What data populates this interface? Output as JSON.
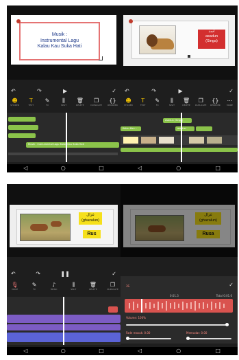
{
  "panel1": {
    "title_lines": [
      "Musik :",
      "Instrumental Lagu",
      "Kalau Kau Suka Hati"
    ],
    "music_clip_label": "Musik : Instrumental Lagu Kalau Kau Suka Hati",
    "tools": [
      {
        "icon": "sticker",
        "label": "STICKER"
      },
      {
        "icon": "T",
        "label": "TEXT"
      },
      {
        "icon": "pen",
        "label": "FX"
      },
      {
        "icon": "split",
        "label": "SPLIT"
      },
      {
        "icon": "delete",
        "label": "DELETE"
      },
      {
        "icon": "copy",
        "label": "DUPLICATE"
      },
      {
        "icon": "reorder",
        "label": "REORDER"
      }
    ]
  },
  "panel2": {
    "arabic_word": "أسد",
    "latin_word": "asadun",
    "meaning": "(Singa)",
    "clip_label_1": "asadun (Singa)",
    "clip_label_2": "Kalau Kau...",
    "clip_label_3": "asadun",
    "tools": [
      {
        "icon": "sticker",
        "label": "STICKER"
      },
      {
        "icon": "T",
        "label": "TEXT"
      },
      {
        "icon": "pen",
        "label": "FX"
      },
      {
        "icon": "split",
        "label": "SPLIT"
      },
      {
        "icon": "delete",
        "label": "DELETE"
      },
      {
        "icon": "copy",
        "label": "DUPLICATE"
      },
      {
        "icon": "reorder",
        "label": "REORDER"
      },
      {
        "icon": "more",
        "label": "MORE"
      }
    ]
  },
  "panel3": {
    "arabic_word": "غزال",
    "latin_word": "(ghazalun)",
    "meaning": "Rus",
    "tools": [
      {
        "icon": "mic",
        "label": "VOICE"
      },
      {
        "icon": "pen",
        "label": "FX"
      },
      {
        "icon": "music",
        "label": "MUSIC"
      },
      {
        "icon": "split",
        "label": "SPLIT"
      },
      {
        "icon": "delete",
        "label": "DELETE"
      },
      {
        "icon": "copy",
        "label": "DUPLICATE"
      }
    ]
  },
  "panel4": {
    "arabic_word": "غزال",
    "latin_word": "(ghazalun)",
    "meaning": "Rusa",
    "header_value": "3S",
    "time_current": "0:01.3",
    "time_total": "Total 0:01.6",
    "volume_label": "Volume: 100%",
    "fade_in_label": "Fade masuk: 0.00",
    "fade_out_label": "Memudar: 0.00",
    "volume_fraction": 1.0
  },
  "colors": {
    "accent_yellow": "#f0c000",
    "timeline_green": "#8bc34a",
    "timeline_purple": "#7c5cc4",
    "timeline_blue": "#5b63d6",
    "timeline_red": "#d9534f"
  }
}
